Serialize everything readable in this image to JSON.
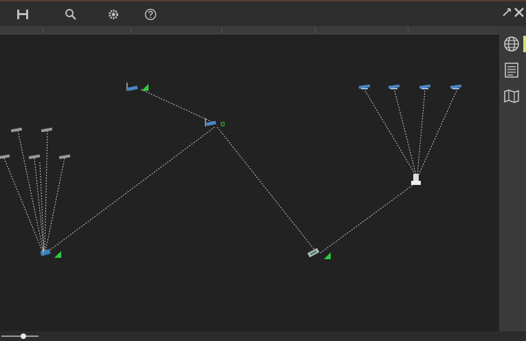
{
  "toolbar": {
    "tools": [
      {
        "name": "save-tool",
        "icon": "save-icon",
        "label": ""
      },
      {
        "name": "search-tool",
        "icon": "search-icon",
        "label": ""
      },
      {
        "name": "settings-tool",
        "icon": "gear-icon",
        "label": ""
      },
      {
        "name": "help-tool",
        "icon": "help-icon",
        "label": ""
      }
    ],
    "window_controls": [
      "pin-icon",
      "close-icon"
    ]
  },
  "columns": [
    "",
    "",
    "",
    "",
    "",
    ""
  ],
  "side_panel": {
    "buttons": [
      "globe-icon",
      "list-icon",
      "map-icon"
    ],
    "accent_color": "#cfe06a"
  },
  "topology": {
    "link_color": "#d0d0d0",
    "signal_color": "#2ecc40",
    "nodes": [
      {
        "id": "ap-left",
        "type": "access-point",
        "label": "",
        "signal": true
      },
      {
        "id": "ap-top",
        "type": "access-point",
        "label": "",
        "signal": true
      },
      {
        "id": "ap-center",
        "type": "access-point",
        "label": "",
        "signal": true
      },
      {
        "id": "router-right",
        "type": "router",
        "label": "",
        "signal": true
      },
      {
        "id": "hub-right",
        "type": "hub",
        "label": ""
      },
      {
        "id": "client-l1",
        "type": "client",
        "label": ""
      },
      {
        "id": "client-l2",
        "type": "client",
        "label": ""
      },
      {
        "id": "client-l3",
        "type": "client",
        "label": ""
      },
      {
        "id": "client-l4",
        "type": "client",
        "label": ""
      },
      {
        "id": "client-l5",
        "type": "client",
        "label": ""
      },
      {
        "id": "client-l6",
        "type": "client",
        "label": ""
      },
      {
        "id": "client-r1",
        "type": "client",
        "label": ""
      },
      {
        "id": "client-r2",
        "type": "client",
        "label": ""
      },
      {
        "id": "client-r3",
        "type": "client",
        "label": ""
      },
      {
        "id": "client-r4",
        "type": "client",
        "label": ""
      }
    ],
    "links": [
      [
        "ap-top",
        "ap-center"
      ],
      [
        "ap-center",
        "ap-left"
      ],
      [
        "ap-center",
        "router-right"
      ],
      [
        "router-right",
        "hub-right"
      ],
      [
        "client-l1",
        "ap-left"
      ],
      [
        "client-l2",
        "ap-left"
      ],
      [
        "client-l3",
        "ap-left"
      ],
      [
        "client-l4",
        "ap-left"
      ],
      [
        "client-l5",
        "ap-left"
      ],
      [
        "client-l6",
        "ap-left"
      ],
      [
        "client-r1",
        "hub-right"
      ],
      [
        "client-r2",
        "hub-right"
      ],
      [
        "client-r3",
        "hub-right"
      ],
      [
        "client-r4",
        "hub-right"
      ]
    ]
  },
  "zoom": {
    "level": 0.6
  }
}
